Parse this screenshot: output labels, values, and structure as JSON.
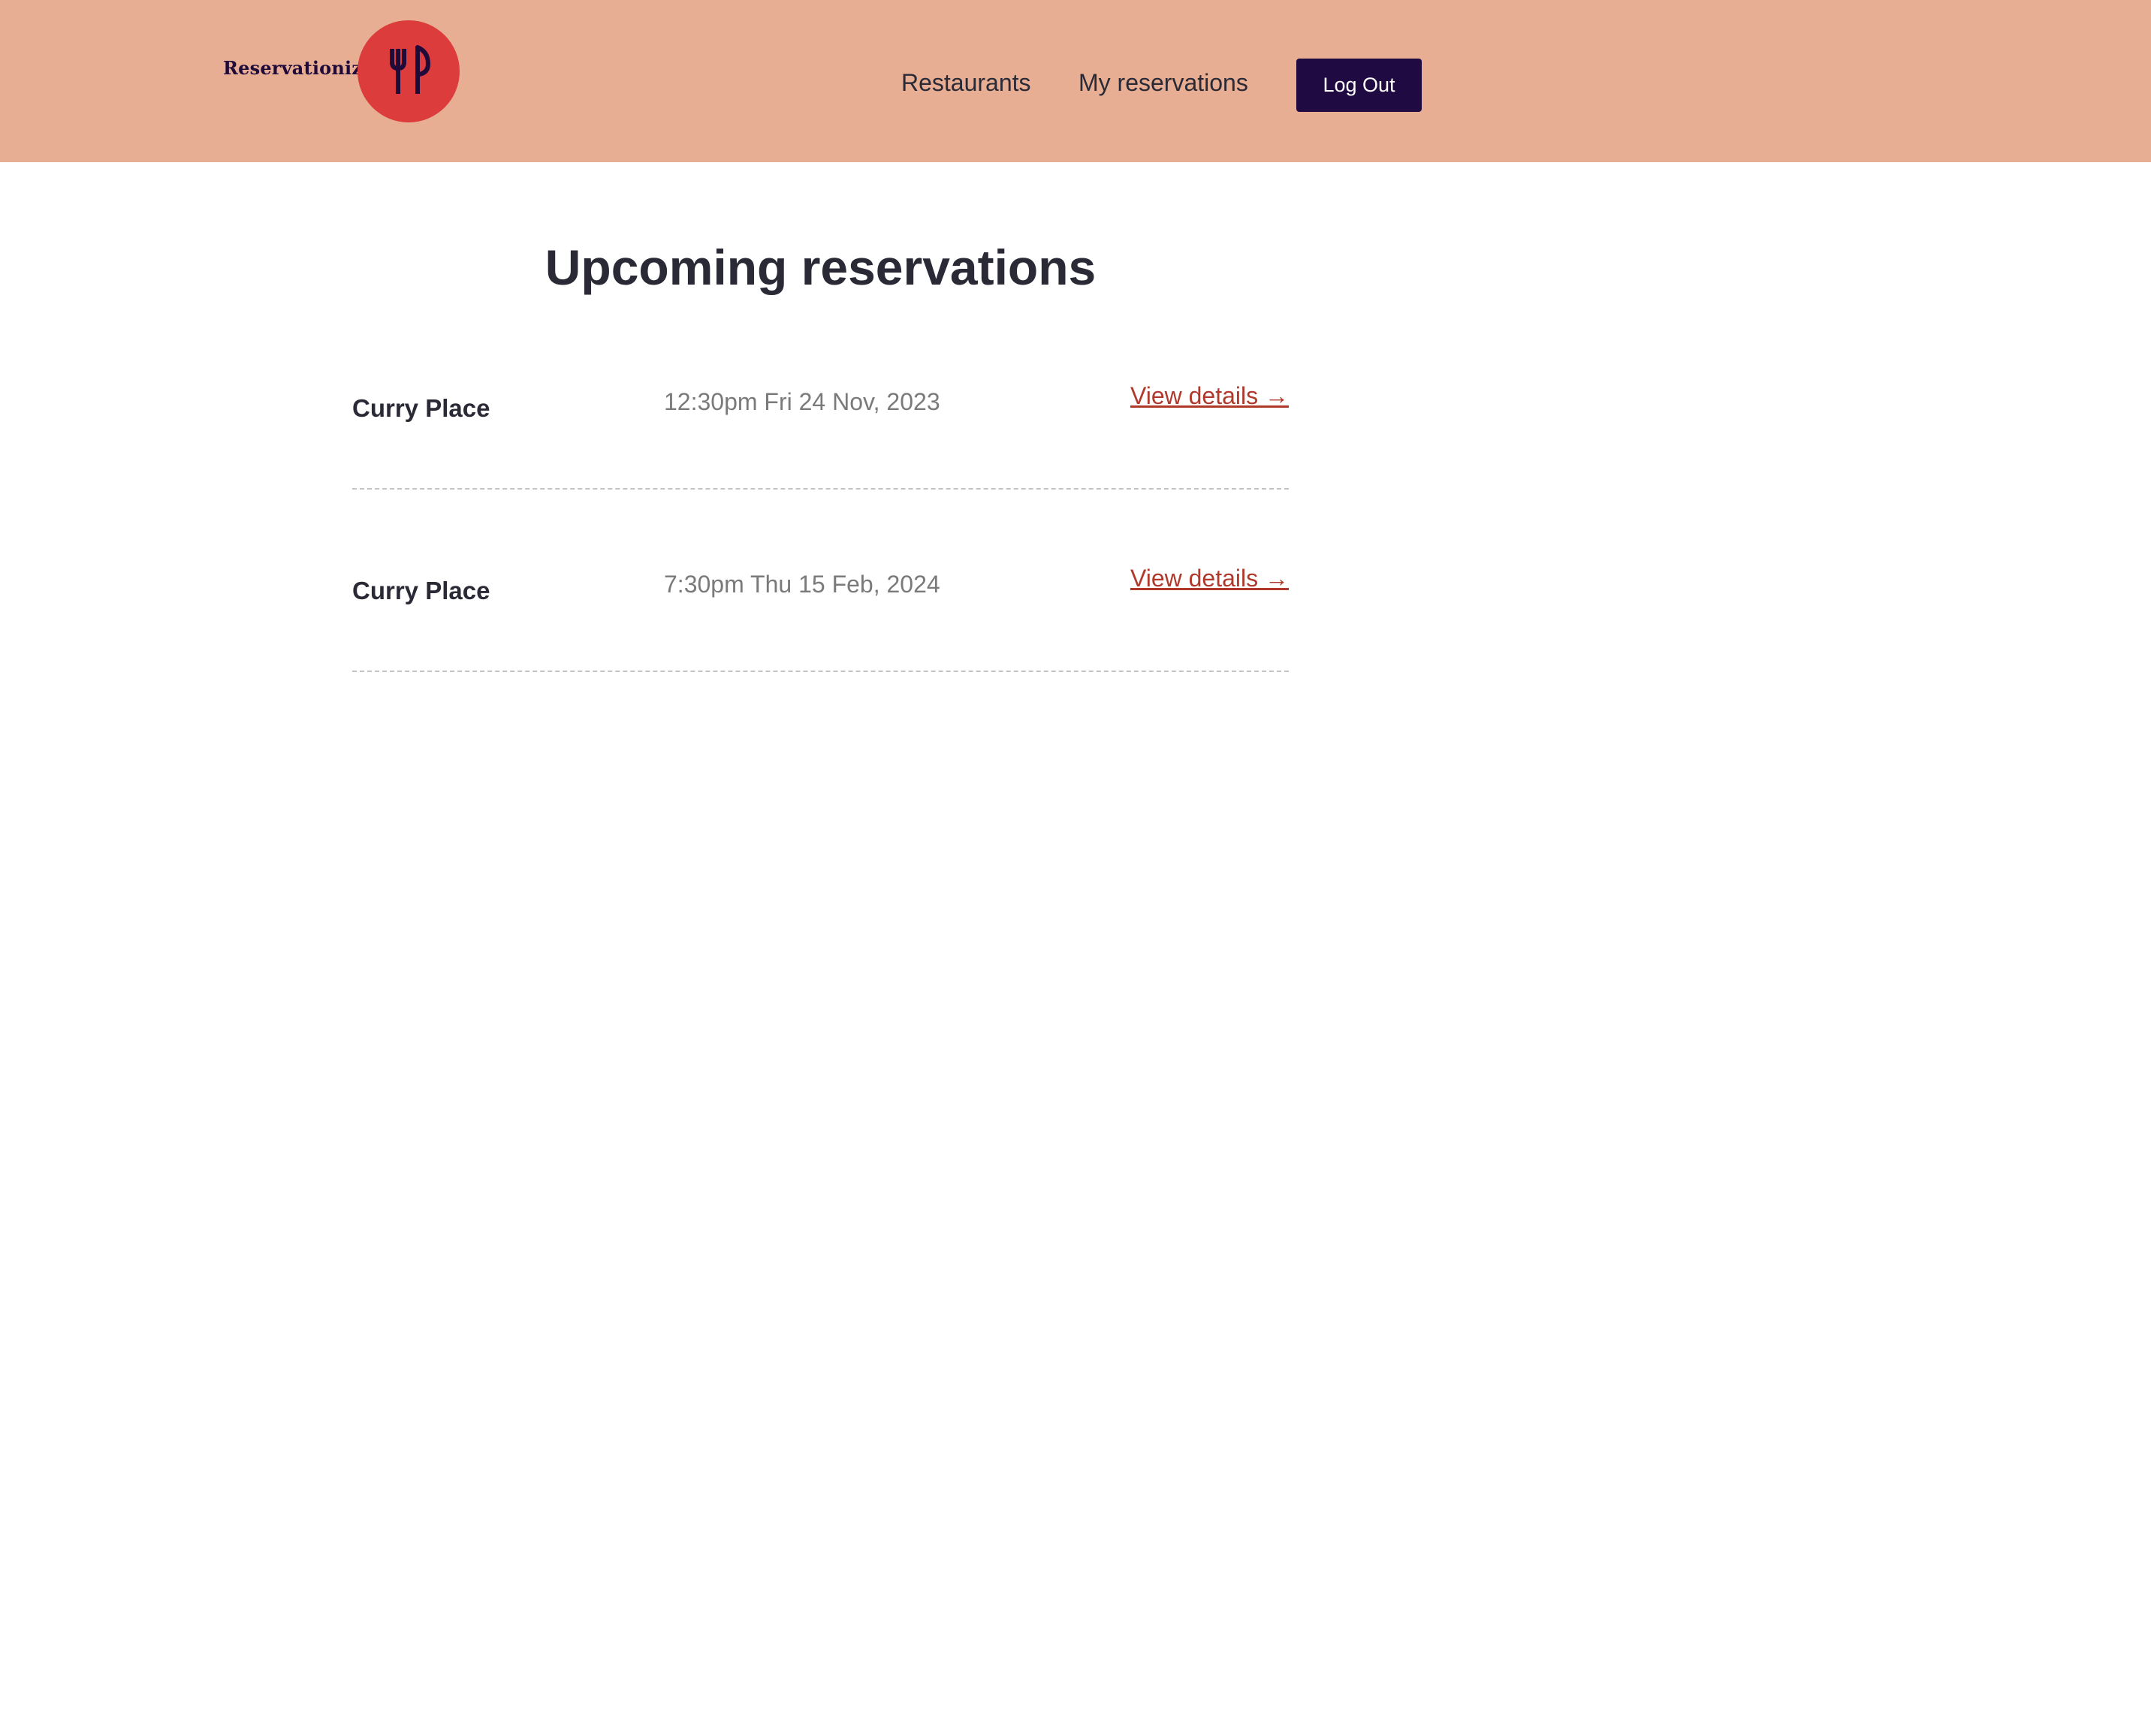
{
  "header": {
    "brand_name": "Reservationizr",
    "logo_icon": "fork-and-knife-icon",
    "nav": {
      "restaurants": "Restaurants",
      "my_reservations": "My reservations"
    },
    "logout_label": "Log Out"
  },
  "main": {
    "title": "Upcoming reservations",
    "reservations": [
      {
        "restaurant": "Curry Place",
        "datetime": "12:30pm Fri 24 Nov, 2023",
        "link": "View details →"
      },
      {
        "restaurant": "Curry Place",
        "datetime": "7:30pm Thu 15 Feb, 2024",
        "link": "View details →"
      }
    ]
  },
  "colors": {
    "header_bg": "#e7ae93",
    "logo_bg": "#dc3c3c",
    "button_bg": "#200a42",
    "link": "#b0392c",
    "text": "#2a2a36"
  }
}
